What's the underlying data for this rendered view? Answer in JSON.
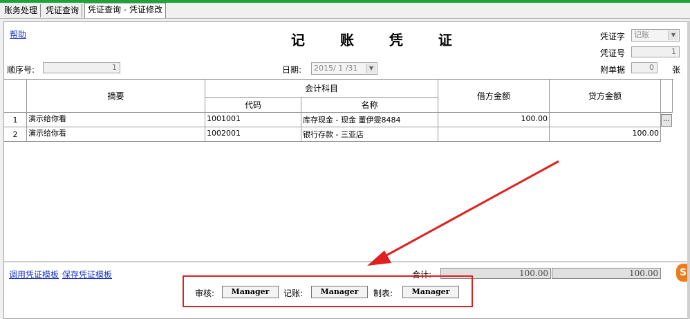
{
  "tabs": [
    "账务处理",
    "凭证查询",
    "凭证查询 - 凭证修改"
  ],
  "help_link": "帮助",
  "title": "记 账 凭 证",
  "voucher_word": {
    "label": "凭证字",
    "value": "记账"
  },
  "voucher_no": {
    "label": "凭证号",
    "value": "1"
  },
  "attachments": {
    "label": "附单据",
    "value": "0",
    "unit": "张"
  },
  "seq": {
    "label": "顺序号:",
    "value": "1"
  },
  "date": {
    "label": "日期:",
    "value": "2015/ 1 /31"
  },
  "table": {
    "headers": {
      "summary": "摘要",
      "account": "会计科目",
      "code": "代码",
      "name": "名称",
      "debit": "借方金额",
      "credit": "贷方金额"
    },
    "rows": [
      {
        "no": "1",
        "summary": "演示给你看",
        "code": "1001001",
        "name": "库存现金 - 现金 董伊雯8484",
        "debit": "100.00",
        "credit": ""
      },
      {
        "no": "2",
        "summary": "演示给你看",
        "code": "1002001",
        "name": "银行存款 - 三亚店",
        "debit": "",
        "credit": "100.00"
      }
    ]
  },
  "ellipsis": "...",
  "links": {
    "use_template": "调用凭证模板",
    "save_template": "保存凭证模板"
  },
  "total": {
    "label": "合计:",
    "debit": "100.00",
    "credit": "100.00"
  },
  "sign": {
    "review_label": "审核:",
    "review_value": "Manager",
    "book_label": "记账:",
    "book_value": "Manager",
    "make_label": "制表:",
    "make_value": "Manager"
  },
  "colors": {
    "accent_bar": "#1fa23a",
    "annotation": "#e02020",
    "link": "#1a33cc"
  }
}
